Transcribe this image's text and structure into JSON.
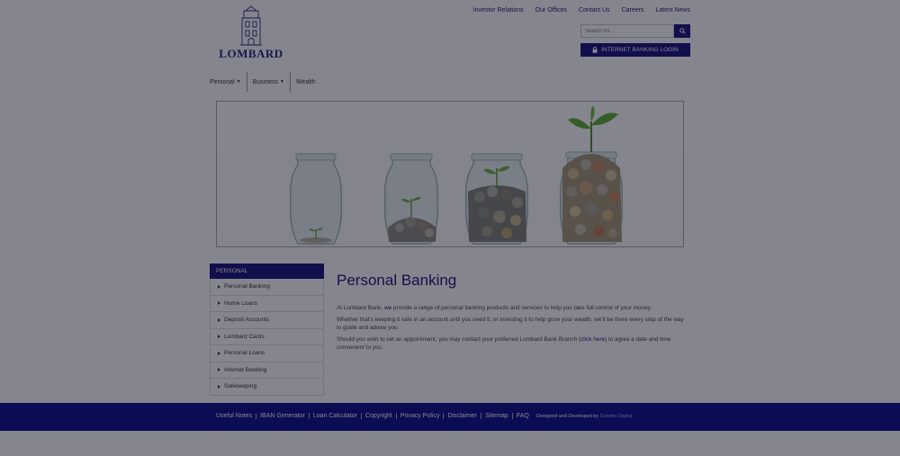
{
  "top_nav": [
    "Investor Relations",
    "Our Offices",
    "Contact Us",
    "Careers",
    "Latest News"
  ],
  "logo": {
    "text": "LOMBARD"
  },
  "search": {
    "placeholder": "Search for..."
  },
  "login": {
    "label": "INTERNET BANKING LOGIN"
  },
  "main_nav": [
    "Personal",
    "Business",
    "Wealth"
  ],
  "sidebar": {
    "title": "PERSONAL",
    "items": [
      "Personal Banking",
      "Home Loans",
      "Deposit Accounts",
      "Lombard Cards",
      "Personal Loans",
      "Internet Banking",
      "Safekeeping"
    ]
  },
  "content": {
    "title": "Personal Banking",
    "p1_a": "At Lombard Bank, ",
    "p1_link": "we",
    "p1_b": " provide a range of personal banking products and services to help you take full control of your money.",
    "p2": "Whether that's keeping it safe in an account until you need it, or investing it to help grow your wealth, we'll be there every step of the way to guide and advise you.",
    "p3_a": "Should you wish to set an appointment, you may contact your preferred Lombard Bank Branch (",
    "p3_link": "click here",
    "p3_b": ") to agree a date and time convenient to you."
  },
  "footer": {
    "links": [
      "Useful Notes",
      "IBAN Generator",
      "Loan Calculator",
      "Copyright",
      "Privacy Policy",
      "Disclaimer",
      "Sitemap",
      "FAQ"
    ],
    "credit": "Designed and Developed by",
    "agency": "Deloitte Digital"
  },
  "colors": {
    "brand_navy": "#16137a",
    "footer_blue": "#0b0d8a"
  },
  "icons": {
    "search": "search-icon",
    "login": "lock-icon",
    "dropdown": "caret-down-icon",
    "sidebar_bullet": "caret-right-icon"
  }
}
